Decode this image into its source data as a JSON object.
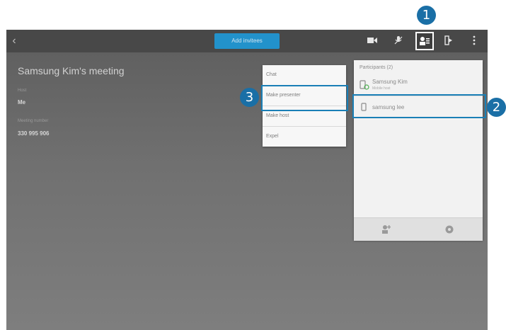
{
  "header": {
    "back_icon": "back-arrow-icon",
    "blue_button_label": "Add invitees",
    "toolbar_icons": [
      "video-camera-icon",
      "mute-mic-icon",
      "participants-icon",
      "exit-icon",
      "more-vertical-icon"
    ]
  },
  "meeting": {
    "title": "Samsung Kim's meeting",
    "host_label": "Host",
    "host_value": "Me",
    "number_label": "Meeting number",
    "number_value": "330 995 906"
  },
  "menu": {
    "items": [
      "Chat",
      "Make presenter",
      "Make host",
      "Expel"
    ]
  },
  "participants": {
    "header": "Participants (2)",
    "items": [
      {
        "name": "Samsung Kim",
        "sub": "Mobile host",
        "icon": "phone-check-icon"
      },
      {
        "name": "samsung lee",
        "sub": "",
        "icon": "phone-icon"
      }
    ],
    "bottom_icons": [
      "add-person-icon",
      "settings-icon"
    ]
  },
  "callouts": [
    "1",
    "2",
    "3"
  ],
  "colors": {
    "accent": "#1a6fa6",
    "button_blue": "#2196d3"
  }
}
